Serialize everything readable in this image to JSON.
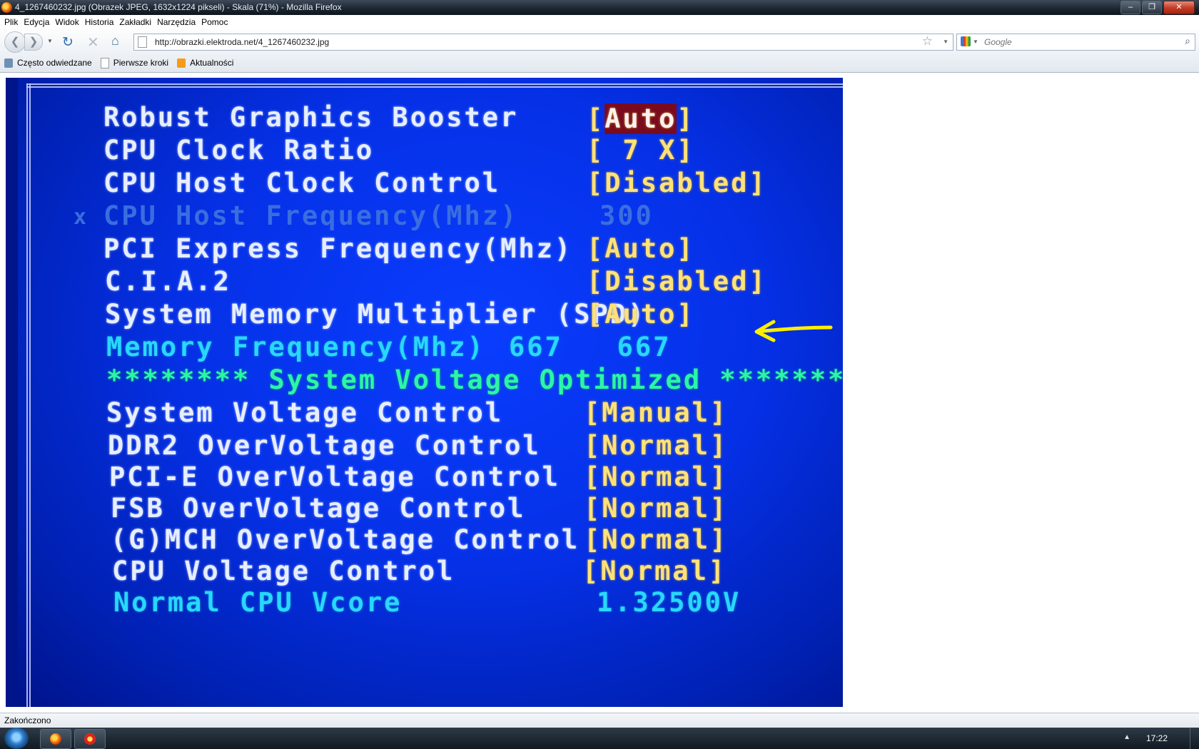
{
  "window": {
    "title": "4_1267460232.jpg (Obrazek JPEG, 1632x1224 pikseli) - Skala (71%) - Mozilla Firefox",
    "minimize_glyph": "–",
    "maximize_glyph": "❐",
    "close_glyph": "✕"
  },
  "menu": {
    "items": [
      "Plik",
      "Edycja",
      "Widok",
      "Historia",
      "Zakładki",
      "Narzędzia",
      "Pomoc"
    ]
  },
  "nav": {
    "back_icon": "arrow-left-icon",
    "back_glyph": "❮",
    "forward_icon": "arrow-right-icon",
    "forward_glyph": "❯",
    "history_dropdown_glyph": "▼",
    "reload_icon": "reload-icon",
    "reload_glyph": "↻",
    "stop_icon": "stop-icon",
    "stop_glyph": "✕",
    "home_icon": "home-icon",
    "home_glyph": "⌂",
    "url": "http://obrazki.elektroda.net/4_1267460232.jpg",
    "bookmark_star_glyph": "☆",
    "url_dropdown_glyph": "▼",
    "search_engine_dropdown_glyph": "▼",
    "search_placeholder": "Google",
    "search_glyph": "⌕"
  },
  "bookmarks": [
    {
      "label": "Często odwiedzane",
      "icon": "most-visited-icon"
    },
    {
      "label": "Pierwsze kroki",
      "icon": "page-icon"
    },
    {
      "label": "Aktualności",
      "icon": "rss-feed-icon"
    }
  ],
  "bios": {
    "settings": [
      {
        "label": "Robust Graphics Booster",
        "value": "Auto"
      },
      {
        "label": "CPU Clock Ratio",
        "value": "[ 7 X]"
      },
      {
        "label": "CPU Host Clock Control",
        "value": "[Disabled]"
      },
      {
        "label": "CPU Host Frequency(Mhz)",
        "value": "300",
        "disabled_mark": "x"
      },
      {
        "label": "PCI Express Frequency(Mhz)",
        "value": "[Auto]"
      },
      {
        "label": "C.I.A.2",
        "value": "[Disabled]"
      },
      {
        "label": "System Memory Multiplier (SPD)",
        "value": "[Auto]"
      },
      {
        "label": "Memory Frequency(Mhz)",
        "value": "667   667"
      },
      {
        "label": "******** System Voltage Optimized ********"
      },
      {
        "label": "System Voltage Control",
        "value": "[Manual]"
      },
      {
        "label": "DDR2 OverVoltage Control",
        "value": "[Normal]"
      },
      {
        "label": "PCI-E OverVoltage Control",
        "value": "[Normal]"
      },
      {
        "label": "FSB OverVoltage Control",
        "value": "[Normal]"
      },
      {
        "label": "(G)MCH OverVoltage Control",
        "value": "[Normal]"
      },
      {
        "label": "CPU Voltage Control",
        "value": "[Normal]"
      },
      {
        "label": "Normal CPU Vcore",
        "value": "1.32500V"
      }
    ],
    "bracket_open": "[",
    "bracket_close": "]",
    "arrow_color": "#ffee00"
  },
  "status": {
    "text": "Zakończono"
  },
  "taskbar": {
    "apps": [
      {
        "name": "firefox-icon"
      },
      {
        "name": "opera-icon"
      }
    ],
    "tray_arrow_glyph": "▲",
    "clock": "17:22"
  }
}
